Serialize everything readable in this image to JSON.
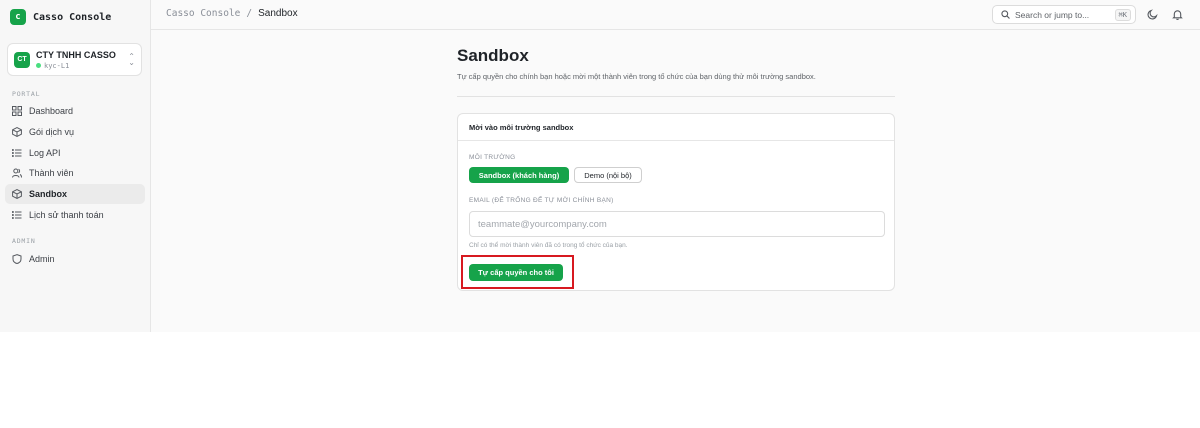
{
  "brand": {
    "logo_letter": "c",
    "name": "Casso Console"
  },
  "org": {
    "avatar": "CT",
    "name": "CTY TNHH CASSO",
    "sub": "kyc-L1",
    "status_color": "#4ade80"
  },
  "sidebar": {
    "portal_label": "PORTAL",
    "items": [
      {
        "label": "Dashboard",
        "icon": "grid-icon"
      },
      {
        "label": "Gói dịch vụ",
        "icon": "box-icon"
      },
      {
        "label": "Log API",
        "icon": "list-icon"
      },
      {
        "label": "Thành viên",
        "icon": "users-icon"
      },
      {
        "label": "Sandbox",
        "icon": "cube-icon",
        "active": true
      },
      {
        "label": "Lịch sử thanh toán",
        "icon": "list-icon"
      }
    ],
    "admin_label": "ADMIN",
    "admin_items": [
      {
        "label": "Admin",
        "icon": "shield-icon"
      }
    ]
  },
  "header": {
    "breadcrumb_root": "Casso Console",
    "separator": "/",
    "breadcrumb_current": "Sandbox",
    "search_placeholder": "Search or jump to...",
    "search_shortcut": "⌘K"
  },
  "page": {
    "title": "Sandbox",
    "description": "Tự cấp quyền cho chính bạn hoặc mời một thành viên trong tổ chức của bạn dùng thử môi trường sandbox."
  },
  "card": {
    "title": "Mời vào môi trường sandbox",
    "env_label": "MÔI TRƯỜNG",
    "env_options": [
      "Sandbox (khách hàng)",
      "Demo (nội bộ)"
    ],
    "env_selected": "Sandbox (khách hàng)",
    "email_label": "EMAIL (ĐỂ TRỐNG ĐỂ TỰ MỜI CHÍNH BẠN)",
    "email_placeholder": "teammate@yourcompany.com",
    "email_value": "",
    "hint": "Chỉ có thể mời thành viên đã có trong tổ chức của bạn.",
    "submit_label": "Tự cấp quyền cho tôi"
  },
  "colors": {
    "accent": "#16a34a",
    "highlight": "#d71920"
  }
}
